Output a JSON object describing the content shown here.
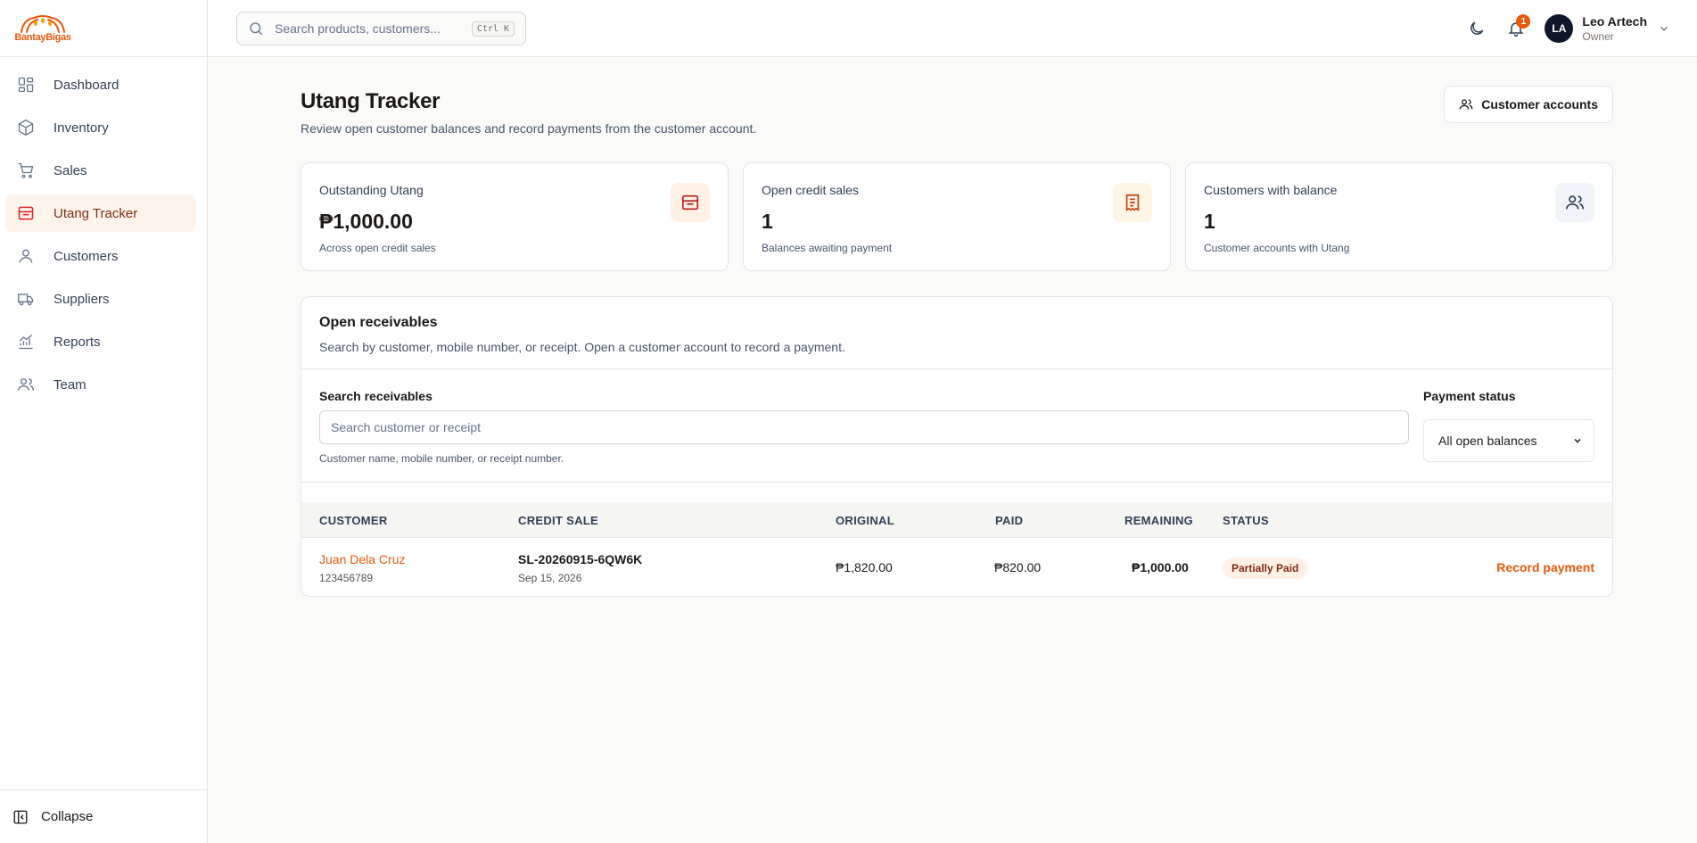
{
  "brand": {
    "name": "BantayBigas",
    "color": "#ea580c"
  },
  "sidebar": {
    "items": [
      {
        "label": "Dashboard",
        "icon": "grid-icon"
      },
      {
        "label": "Inventory",
        "icon": "box-icon"
      },
      {
        "label": "Sales",
        "icon": "cart-icon"
      },
      {
        "label": "Utang Tracker",
        "icon": "wallet-icon",
        "active": true
      },
      {
        "label": "Customers",
        "icon": "user-icon"
      },
      {
        "label": "Suppliers",
        "icon": "truck-icon"
      },
      {
        "label": "Reports",
        "icon": "chart-icon"
      },
      {
        "label": "Team",
        "icon": "team-icon"
      }
    ],
    "collapse_label": "Collapse"
  },
  "topbar": {
    "search_placeholder": "Search products, customers...",
    "shortcut": "Ctrl K",
    "notification_count": "1",
    "user": {
      "initials": "LA",
      "name": "Leo Artech",
      "role": "Owner"
    }
  },
  "page": {
    "title": "Utang Tracker",
    "subtitle": "Review open customer balances and record payments from the customer account.",
    "accounts_button": "Customer accounts"
  },
  "stats": [
    {
      "label": "Outstanding Utang",
      "value": "₱1,000.00",
      "note": "Across open credit sales",
      "icon": "wallet-icon",
      "icon_bg": "#fff1e6",
      "icon_color": "#b91c1c"
    },
    {
      "label": "Open credit sales",
      "value": "1",
      "note": "Balances awaiting payment",
      "icon": "receipt-icon",
      "icon_bg": "#fff5e6",
      "icon_color": "#c2410c"
    },
    {
      "label": "Customers with balance",
      "value": "1",
      "note": "Customer accounts with Utang",
      "icon": "users-icon",
      "icon_bg": "#f1f5f9",
      "icon_color": "#334155"
    }
  ],
  "receivables": {
    "title": "Open receivables",
    "subtitle": "Search by customer, mobile number, or receipt. Open a customer account to record a payment.",
    "search_label": "Search receivables",
    "search_placeholder": "Search customer or receipt",
    "search_hint": "Customer name, mobile number, or receipt number.",
    "status_label": "Payment status",
    "status_selected": "All open balances",
    "columns": [
      "CUSTOMER",
      "CREDIT SALE",
      "ORIGINAL",
      "PAID",
      "REMAINING",
      "STATUS"
    ],
    "rows": [
      {
        "customer": "Juan Dela Cruz",
        "mobile": "123456789",
        "sale_id": "SL-20260915-6QW6K",
        "sale_date": "Sep 15, 2026",
        "original": "₱1,820.00",
        "paid": "₱820.00",
        "remaining": "₱1,000.00",
        "status": "Partially Paid",
        "action": "Record payment"
      }
    ]
  }
}
